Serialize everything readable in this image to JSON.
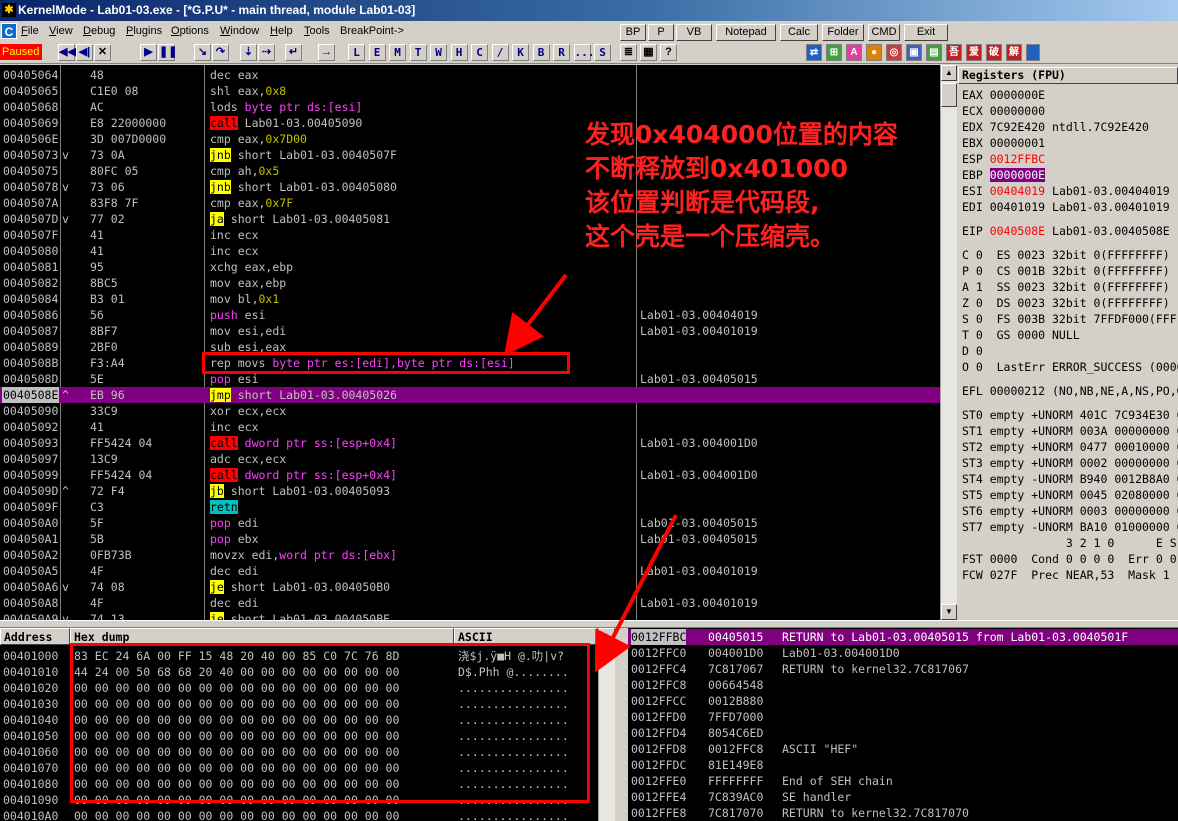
{
  "window": {
    "title": "KernelMode - Lab01-03.exe - [*G.P.U* - main thread, module Lab01-03]",
    "app_icon": "ollydbg-bug-icon"
  },
  "menu": {
    "app_icon_letter": "C",
    "items": [
      {
        "label": "File",
        "ul": "F"
      },
      {
        "label": "View",
        "ul": "V"
      },
      {
        "label": "Debug",
        "ul": "D"
      },
      {
        "label": "Plugins",
        "ul": "P"
      },
      {
        "label": "Options",
        "ul": "O"
      },
      {
        "label": "Window",
        "ul": "W"
      },
      {
        "label": "Help",
        "ul": "H"
      },
      {
        "label": "Tools",
        "ul": "T"
      },
      {
        "label": "BreakPoint->",
        "ul": ""
      }
    ],
    "right_buttons": [
      "BP",
      "P",
      "VB",
      "Notepad",
      "Calc",
      "Folder",
      "CMD",
      "Exit"
    ]
  },
  "toolbar": {
    "status": "Paused",
    "letter_buttons": [
      "L",
      "E",
      "M",
      "T",
      "W",
      "H",
      "C",
      "/",
      "K",
      "B",
      "R",
      "...",
      "S"
    ],
    "chinese_buttons": [
      "吾",
      "爱",
      "破",
      "解"
    ]
  },
  "disasm": {
    "rows": [
      {
        "addr": "00405064",
        "mark": "",
        "hex": "48",
        "mn": "dec",
        "mnc": "kw",
        "ops": [
          [
            "eax",
            "op-reg"
          ]
        ],
        "cmt": ""
      },
      {
        "addr": "00405065",
        "mark": "",
        "hex": "C1E0 08",
        "mn": "shl",
        "mnc": "kw",
        "ops": [
          [
            "eax,",
            "op-reg"
          ],
          [
            "0x8",
            "op-num"
          ]
        ],
        "cmt": ""
      },
      {
        "addr": "00405068",
        "mark": "",
        "hex": "AC",
        "mn": "lods",
        "mnc": "kw",
        "ops": [
          [
            "byte ptr ds:[esi]",
            "op-mem"
          ]
        ],
        "cmt": ""
      },
      {
        "addr": "00405069",
        "mark": "",
        "hex": "E8 22000000",
        "mn": "call",
        "mnc": "kw-call",
        "ops": [
          [
            "Lab01-03.00405090",
            "op-reg"
          ]
        ],
        "cmt": ""
      },
      {
        "addr": "0040506E",
        "mark": "",
        "hex": "3D 007D0000",
        "mn": "cmp",
        "mnc": "kw",
        "ops": [
          [
            "eax,",
            "op-reg"
          ],
          [
            "0x7D00",
            "op-num"
          ]
        ],
        "cmt": ""
      },
      {
        "addr": "00405073",
        "mark": "v",
        "hex": "73 0A",
        "mn": "jnb",
        "mnc": "kw-jcc",
        "ops": [
          [
            "short Lab01-03.0040507F",
            "op-reg"
          ]
        ],
        "cmt": ""
      },
      {
        "addr": "00405075",
        "mark": "",
        "hex": "80FC 05",
        "mn": "cmp",
        "mnc": "kw",
        "ops": [
          [
            "ah,",
            "op-reg"
          ],
          [
            "0x5",
            "op-num"
          ]
        ],
        "cmt": ""
      },
      {
        "addr": "00405078",
        "mark": "v",
        "hex": "73 06",
        "mn": "jnb",
        "mnc": "kw-jcc",
        "ops": [
          [
            "short Lab01-03.00405080",
            "op-reg"
          ]
        ],
        "cmt": ""
      },
      {
        "addr": "0040507A",
        "mark": "",
        "hex": "83F8 7F",
        "mn": "cmp",
        "mnc": "kw",
        "ops": [
          [
            "eax,",
            "op-reg"
          ],
          [
            "0x7F",
            "op-num"
          ]
        ],
        "cmt": ""
      },
      {
        "addr": "0040507D",
        "mark": "v",
        "hex": "77 02",
        "mn": "ja",
        "mnc": "kw-jcc",
        "ops": [
          [
            "short Lab01-03.00405081",
            "op-reg"
          ]
        ],
        "cmt": ""
      },
      {
        "addr": "0040507F",
        "mark": "",
        "hex": "41",
        "mn": "inc",
        "mnc": "kw",
        "ops": [
          [
            "ecx",
            "op-reg"
          ]
        ],
        "cmt": ""
      },
      {
        "addr": "00405080",
        "mark": "",
        "hex": "41",
        "mn": "inc",
        "mnc": "kw",
        "ops": [
          [
            "ecx",
            "op-reg"
          ]
        ],
        "cmt": ""
      },
      {
        "addr": "00405081",
        "mark": "",
        "hex": "95",
        "mn": "xchg",
        "mnc": "kw",
        "ops": [
          [
            "eax,ebp",
            "op-reg"
          ]
        ],
        "cmt": ""
      },
      {
        "addr": "00405082",
        "mark": "",
        "hex": "8BC5",
        "mn": "mov",
        "mnc": "kw",
        "ops": [
          [
            "eax,ebp",
            "op-reg"
          ]
        ],
        "cmt": ""
      },
      {
        "addr": "00405084",
        "mark": "",
        "hex": "B3 01",
        "mn": "mov",
        "mnc": "kw",
        "ops": [
          [
            "bl,",
            "op-reg"
          ],
          [
            "0x1",
            "op-num"
          ]
        ],
        "cmt": ""
      },
      {
        "addr": "00405086",
        "mark": "",
        "hex": "56",
        "mn": "push",
        "mnc": "op-push",
        "ops": [
          [
            "esi",
            "op-reg"
          ]
        ],
        "cmt": "Lab01-03.00404019"
      },
      {
        "addr": "00405087",
        "mark": "",
        "hex": "8BF7",
        "mn": "mov",
        "mnc": "kw",
        "ops": [
          [
            "esi,edi",
            "op-reg"
          ]
        ],
        "cmt": "Lab01-03.00401019"
      },
      {
        "addr": "00405089",
        "mark": "",
        "hex": "2BF0",
        "mn": "sub",
        "mnc": "kw",
        "ops": [
          [
            "esi,eax",
            "op-reg"
          ]
        ],
        "cmt": ""
      },
      {
        "addr": "0040508B",
        "mark": "",
        "hex": "F3:A4",
        "mn": "rep movs",
        "mnc": "kw",
        "ops": [
          [
            "byte ptr es:[edi],byte ptr ds:[esi]",
            "op-mem"
          ]
        ],
        "cmt": ""
      },
      {
        "addr": "0040508D",
        "mark": "",
        "hex": "5E",
        "mn": "pop",
        "mnc": "op-push",
        "ops": [
          [
            "esi",
            "op-reg"
          ]
        ],
        "cmt": "Lab01-03.00405015"
      },
      {
        "addr": "0040508E",
        "mark": "^",
        "hex": "EB 96",
        "mn": "jmp",
        "mnc": "kw-jcc",
        "ops": [
          [
            "short Lab01-03.00405026",
            "op-reg"
          ]
        ],
        "cmt": "",
        "eip": true
      },
      {
        "addr": "00405090",
        "mark": "",
        "hex": "33C9",
        "mn": "xor",
        "mnc": "kw",
        "ops": [
          [
            "ecx,ecx",
            "op-reg"
          ]
        ],
        "cmt": ""
      },
      {
        "addr": "00405092",
        "mark": "",
        "hex": "41",
        "mn": "inc",
        "mnc": "kw",
        "ops": [
          [
            "ecx",
            "op-reg"
          ]
        ],
        "cmt": ""
      },
      {
        "addr": "00405093",
        "mark": "",
        "hex": "FF5424 04",
        "mn": "call",
        "mnc": "kw-call",
        "ops": [
          [
            "dword ptr ss:[esp+0x4]",
            "op-mem"
          ]
        ],
        "cmt": "Lab01-03.004001D0"
      },
      {
        "addr": "00405097",
        "mark": "",
        "hex": "13C9",
        "mn": "adc",
        "mnc": "kw",
        "ops": [
          [
            "ecx,ecx",
            "op-reg"
          ]
        ],
        "cmt": ""
      },
      {
        "addr": "00405099",
        "mark": "",
        "hex": "FF5424 04",
        "mn": "call",
        "mnc": "kw-call",
        "ops": [
          [
            "dword ptr ss:[esp+0x4]",
            "op-mem"
          ]
        ],
        "cmt": "Lab01-03.004001D0"
      },
      {
        "addr": "0040509D",
        "mark": "^",
        "hex": "72 F4",
        "mn": "jb",
        "mnc": "kw-jcc",
        "ops": [
          [
            "short Lab01-03.00405093",
            "op-reg"
          ]
        ],
        "cmt": ""
      },
      {
        "addr": "0040509F",
        "mark": "",
        "hex": "C3",
        "mn": "retn",
        "mnc": "kw-retn",
        "ops": [],
        "cmt": ""
      },
      {
        "addr": "004050A0",
        "mark": "",
        "hex": "5F",
        "mn": "pop",
        "mnc": "op-push",
        "ops": [
          [
            "edi",
            "op-reg"
          ]
        ],
        "cmt": "Lab01-03.00405015"
      },
      {
        "addr": "004050A1",
        "mark": "",
        "hex": "5B",
        "mn": "pop",
        "mnc": "op-push",
        "ops": [
          [
            "ebx",
            "op-reg"
          ]
        ],
        "cmt": "Lab01-03.00405015"
      },
      {
        "addr": "004050A2",
        "mark": "",
        "hex": "0FB73B",
        "mn": "movzx",
        "mnc": "kw",
        "ops": [
          [
            "edi,",
            "op-reg"
          ],
          [
            "word ptr ds:[ebx]",
            "op-mem"
          ]
        ],
        "cmt": ""
      },
      {
        "addr": "004050A5",
        "mark": "",
        "hex": "4F",
        "mn": "dec",
        "mnc": "kw",
        "ops": [
          [
            "edi",
            "op-reg"
          ]
        ],
        "cmt": "Lab01-03.00401019"
      },
      {
        "addr": "004050A6",
        "mark": "v",
        "hex": "74 08",
        "mn": "je",
        "mnc": "kw-jcc",
        "ops": [
          [
            "short Lab01-03.004050B0",
            "op-reg"
          ]
        ],
        "cmt": ""
      },
      {
        "addr": "004050A8",
        "mark": "",
        "hex": "4F",
        "mn": "dec",
        "mnc": "kw",
        "ops": [
          [
            "edi",
            "op-reg"
          ]
        ],
        "cmt": "Lab01-03.00401019"
      },
      {
        "addr": "004050A9",
        "mark": "v",
        "hex": "74 13",
        "mn": "je",
        "mnc": "kw-jcc",
        "ops": [
          [
            "short Lab01-03.004050BE",
            "op-reg"
          ]
        ],
        "cmt": ""
      }
    ]
  },
  "registers": {
    "header": "Registers (FPU)",
    "rows": [
      {
        "t": "EAX 0000000E",
        "y": 0
      },
      {
        "t": "ECX 00000000",
        "y": 1
      },
      {
        "t": "EDX 7C92E420 ntdll.7C92E420",
        "y": 2
      },
      {
        "t": "EBX 00000001",
        "y": 3
      },
      {
        "t": "ESP ",
        "r": "0012FFBC",
        "y": 4
      },
      {
        "t": "EBP ",
        "h": "0000000E",
        "y": 5
      },
      {
        "t": "ESI ",
        "r": "00404019",
        "rest": " Lab01-03.00404019",
        "y": 6
      },
      {
        "t": "EDI 00401019 Lab01-03.00401019",
        "y": 7
      },
      {
        "t": "EIP ",
        "r": "0040508E",
        "rest": " Lab01-03.0040508E",
        "y": 8.5
      },
      {
        "t": "C 0  ES 0023 32bit 0(FFFFFFFF)",
        "y": 10
      },
      {
        "t": "P 0  CS 001B 32bit 0(FFFFFFFF)",
        "y": 11
      },
      {
        "t": "A 1  SS 0023 32bit 0(FFFFFFFF)",
        "y": 12
      },
      {
        "t": "Z 0  DS 0023 32bit 0(FFFFFFFF)",
        "y": 13
      },
      {
        "t": "S 0  FS 003B 32bit 7FFDF000(FFF)",
        "y": 14
      },
      {
        "t": "T 0  GS 0000 NULL",
        "y": 15
      },
      {
        "t": "D 0",
        "y": 16
      },
      {
        "t": "O 0  LastErr ERROR_SUCCESS (00000000)",
        "y": 17
      },
      {
        "t": "EFL 00000212 (NO,NB,NE,A,NS,PO,GE,G)",
        "y": 18.5
      },
      {
        "t": "ST0 empty +UNORM 401C 7C934E30 0",
        "y": 20
      },
      {
        "t": "ST1 empty +UNORM 003A 00000000 0",
        "y": 21
      },
      {
        "t": "ST2 empty +UNORM 0477 00010000 0",
        "y": 22
      },
      {
        "t": "ST3 empty +UNORM 0002 00000000 0",
        "y": 23
      },
      {
        "t": "ST4 empty -UNORM B940 0012B8A0 0",
        "y": 24
      },
      {
        "t": "ST5 empty +UNORM 0045 02080000 0",
        "y": 25
      },
      {
        "t": "ST6 empty +UNORM 0003 00000000 0",
        "y": 26
      },
      {
        "t": "ST7 empty -UNORM BA10 01000000 0",
        "y": 27
      },
      {
        "t": "               3 2 1 0      E S P U",
        "y": 28
      },
      {
        "t": "FST 0000  Cond 0 0 0 0  Err 0 0 0 0",
        "y": 29
      },
      {
        "t": "FCW 027F  Prec NEAR,53  Mask 1 1 1 1",
        "y": 30
      }
    ]
  },
  "dump": {
    "headers": {
      "address": "Address",
      "hex": "Hex dump",
      "ascii": "ASCII"
    },
    "rows": [
      {
        "addr": "00401000",
        "hex": "83 EC 24 6A 00 FF 15 48 20 40 00 85 C0 7C 76 8D",
        "ascii": "浇$j.ÿ■H @.叻|v?"
      },
      {
        "addr": "00401010",
        "hex": "44 24 00 50 68 68 20 40 00 00 00 00 00 00 00 00",
        "ascii": "D$.Phh @........"
      },
      {
        "addr": "00401020",
        "hex": "00 00 00 00 00 00 00 00 00 00 00 00 00 00 00 00",
        "ascii": "................"
      },
      {
        "addr": "00401030",
        "hex": "00 00 00 00 00 00 00 00 00 00 00 00 00 00 00 00",
        "ascii": "................"
      },
      {
        "addr": "00401040",
        "hex": "00 00 00 00 00 00 00 00 00 00 00 00 00 00 00 00",
        "ascii": "................"
      },
      {
        "addr": "00401050",
        "hex": "00 00 00 00 00 00 00 00 00 00 00 00 00 00 00 00",
        "ascii": "................"
      },
      {
        "addr": "00401060",
        "hex": "00 00 00 00 00 00 00 00 00 00 00 00 00 00 00 00",
        "ascii": "................"
      },
      {
        "addr": "00401070",
        "hex": "00 00 00 00 00 00 00 00 00 00 00 00 00 00 00 00",
        "ascii": "................"
      },
      {
        "addr": "00401080",
        "hex": "00 00 00 00 00 00 00 00 00 00 00 00 00 00 00 00",
        "ascii": "................"
      },
      {
        "addr": "00401090",
        "hex": "00 00 00 00 00 00 00 00 00 00 00 00 00 00 00 00",
        "ascii": "................"
      },
      {
        "addr": "004010A0",
        "hex": "00 00 00 00 00 00 00 00 00 00 00 00 00 00 00 00",
        "ascii": "................"
      }
    ]
  },
  "stack": {
    "rows": [
      {
        "addr": "0012FFBC",
        "val": "00405015",
        "cmt": "RETURN to Lab01-03.00405015 from Lab01-03.0040501F",
        "top": true
      },
      {
        "addr": "0012FFC0",
        "val": "004001D0",
        "cmt": "Lab01-03.004001D0"
      },
      {
        "addr": "0012FFC4",
        "val": "7C817067",
        "cmt": "RETURN to kernel32.7C817067"
      },
      {
        "addr": "0012FFC8",
        "val": "00664548",
        "cmt": ""
      },
      {
        "addr": "0012FFCC",
        "val": "0012B880",
        "cmt": ""
      },
      {
        "addr": "0012FFD0",
        "val": "7FFD7000",
        "cmt": ""
      },
      {
        "addr": "0012FFD4",
        "val": "8054C6ED",
        "cmt": ""
      },
      {
        "addr": "0012FFD8",
        "val": "0012FFC8",
        "cmt": "ASCII \"HEF\""
      },
      {
        "addr": "0012FFDC",
        "val": "81E149E8",
        "cmt": ""
      },
      {
        "addr": "0012FFE0",
        "val": "FFFFFFFF",
        "cmt": "End of SEH chain"
      },
      {
        "addr": "0012FFE4",
        "val": "7C839AC0",
        "cmt": "SE handler"
      },
      {
        "addr": "0012FFE8",
        "val": "7C817070",
        "cmt": "RETURN to kernel32.7C817070"
      }
    ]
  },
  "annotation": {
    "lines": [
      "发现0x404000位置的内容",
      "不断释放到0x401000",
      "该位置判断是代码段,",
      "这个壳是一个压缩壳。"
    ],
    "color": "#ff2020"
  }
}
